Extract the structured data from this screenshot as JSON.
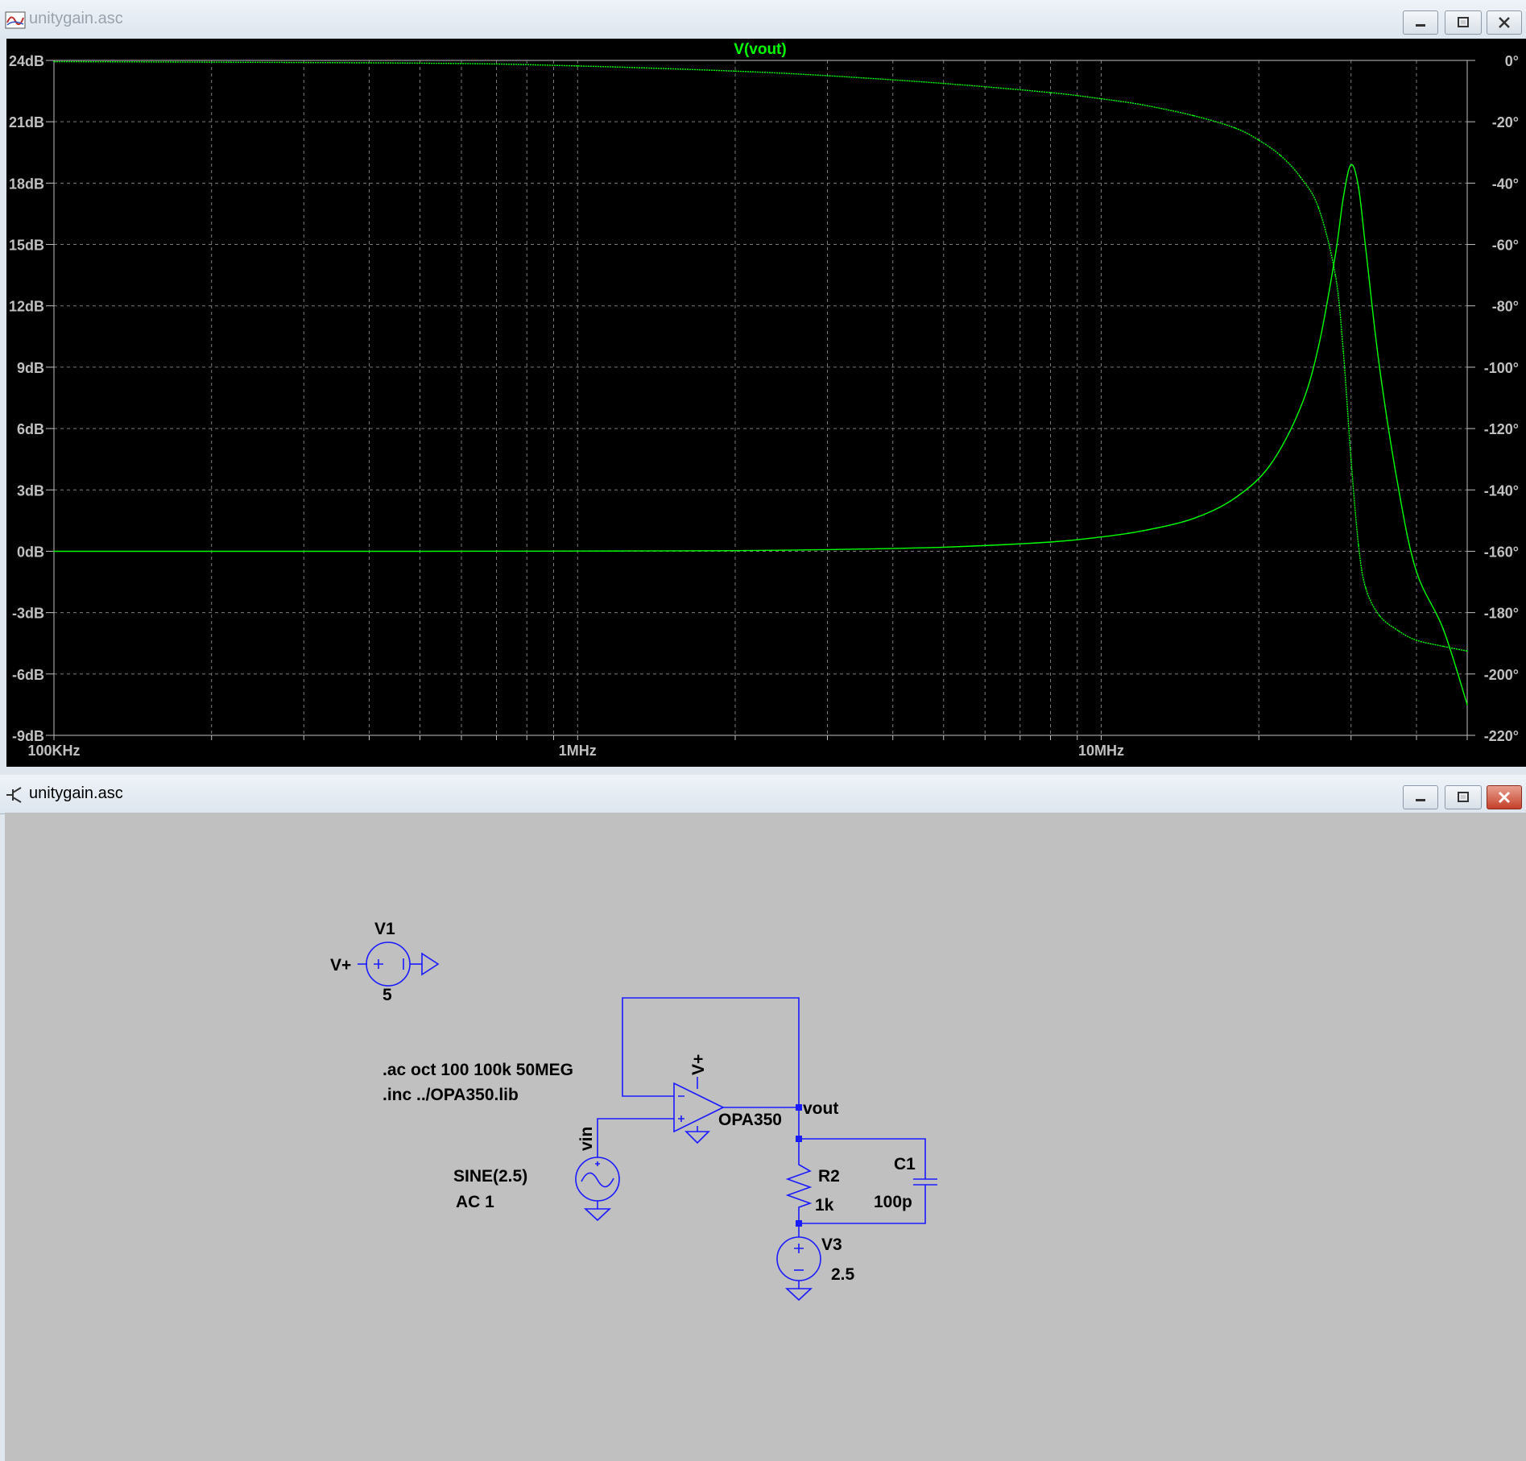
{
  "plot_window": {
    "title": "unitygain.asc",
    "trace_label": "V(vout)",
    "colors": {
      "background": "#000000",
      "trace": "#00ff00",
      "grid": "#7a7a7a",
      "axis_text": "#c0c0c0"
    }
  },
  "schematic_window": {
    "title": "unitygain.asc",
    "colors": {
      "background": "#c0c0c0",
      "wire": "#0000ff",
      "junction": "#0000ff",
      "text": "#000000"
    },
    "components": {
      "v1": {
        "name": "V1",
        "value": "5",
        "net": "V+"
      },
      "opamp": {
        "name": "OPA350",
        "supply_label": "V+"
      },
      "vin": {
        "net": "vin",
        "value_line1": "SINE(2.5)",
        "value_line2": "AC 1"
      },
      "vout": {
        "net": "vout"
      },
      "r2": {
        "name": "R2",
        "value": "1k"
      },
      "c1": {
        "name": "C1",
        "value": "100p"
      },
      "v3": {
        "name": "V3",
        "value": "2.5"
      }
    },
    "directives": [
      ".ac oct 100 100k 50MEG",
      ".inc ../OPA350.lib"
    ]
  },
  "chart_data": {
    "type": "line",
    "title": "V(vout)",
    "x_scale": "log",
    "xlim": [
      100000,
      50000000
    ],
    "x_tick_labels": [
      "100KHz",
      "1MHz",
      "10MHz"
    ],
    "y_left_ticks": [
      "24dB",
      "21dB",
      "18dB",
      "15dB",
      "12dB",
      "9dB",
      "6dB",
      "3dB",
      "0dB",
      "-3dB",
      "-6dB",
      "-9dB"
    ],
    "y_left_lim": [
      -9,
      24
    ],
    "y_right_ticks": [
      "0°",
      "-20°",
      "-40°",
      "-60°",
      "-80°",
      "-100°",
      "-120°",
      "-140°",
      "-160°",
      "-180°",
      "-200°",
      "-220°"
    ],
    "y_right_lim": [
      -220,
      0
    ],
    "grid": true,
    "series": [
      {
        "name": "V(vout)",
        "y_axis": "left",
        "x": [
          100000,
          500000,
          1000000,
          2000000,
          3000000,
          5000000,
          8000000,
          10000000,
          12000000,
          15000000,
          18000000,
          21000000,
          24000000,
          26000000,
          28000000,
          29000000,
          30000000,
          31000000,
          32000000,
          34000000,
          37000000,
          40000000,
          45000000,
          50000000
        ],
        "values": [
          0,
          0,
          0.01,
          0.03,
          0.08,
          0.2,
          0.45,
          0.7,
          1.0,
          1.6,
          2.6,
          4.2,
          7.0,
          10.0,
          14.5,
          17.3,
          18.9,
          17.8,
          14.8,
          9.0,
          3.0,
          -1.0,
          -3.8,
          -7.5
        ]
      },
      {
        "name": "V(vout)",
        "y_axis": "right",
        "x": [
          100000,
          500000,
          1000000,
          2000000,
          3000000,
          5000000,
          8000000,
          10000000,
          12000000,
          15000000,
          18000000,
          20000000,
          22000000,
          24000000,
          26000000,
          28000000,
          29000000,
          30000000,
          31000000,
          32000000,
          34000000,
          37000000,
          40000000,
          45000000,
          50000000
        ],
        "values": [
          -0.4,
          -0.9,
          -1.8,
          -3.5,
          -5.0,
          -7.5,
          -10.5,
          -12.5,
          -14.5,
          -18.0,
          -22.0,
          -26.0,
          -31.0,
          -38.0,
          -48.0,
          -70.0,
          -95.0,
          -130.0,
          -158.0,
          -172.0,
          -181.0,
          -186.0,
          -189.0,
          -191.0,
          -192.5
        ]
      }
    ]
  }
}
